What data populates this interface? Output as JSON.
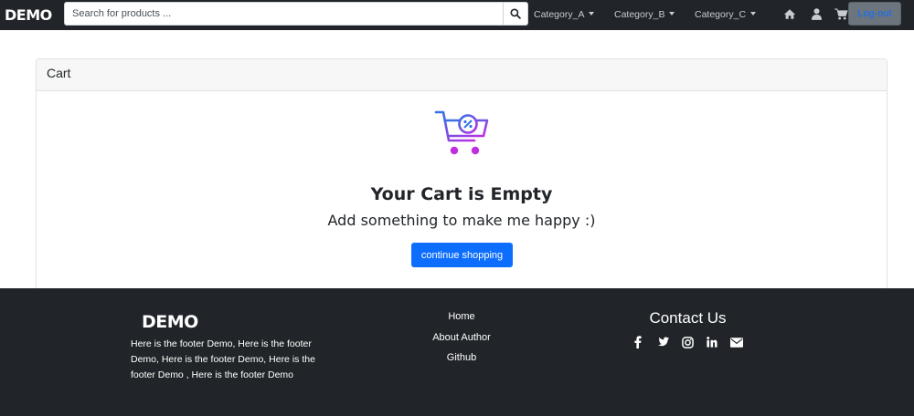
{
  "navbar": {
    "brand": "DEMO",
    "search_placeholder": "Search for products ...",
    "categories": [
      "Category_A",
      "Category_B",
      "Category_C"
    ],
    "logout_label": "Log-out"
  },
  "cart": {
    "header": "Cart",
    "empty_title": "Your Cart is Empty",
    "empty_subtitle": "Add something to make me happy :)",
    "continue_label": "continue shopping"
  },
  "footer": {
    "brand": "DEMO",
    "description": "Here is the footer Demo, Here is the footer Demo, Here is the footer Demo, Here is the footer Demo , Here is the footer Demo",
    "links": [
      "Home",
      "About Author",
      "Github"
    ],
    "contact_title": "Contact Us",
    "socials": [
      "facebook-icon",
      "twitter-icon",
      "instagram-icon",
      "linkedin-icon",
      "envelope-icon"
    ]
  },
  "colors": {
    "nav_bg": "#212529",
    "primary": "#0d6efd",
    "secondary": "#6c757d"
  }
}
